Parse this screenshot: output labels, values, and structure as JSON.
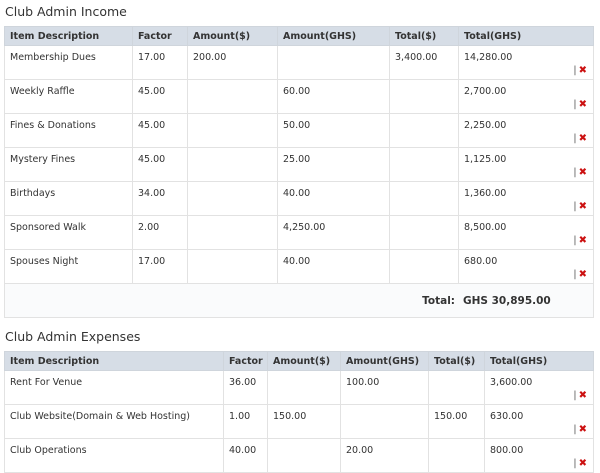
{
  "income": {
    "title": "Club Admin Income",
    "columns": [
      "Item Description",
      "Factor",
      "Amount($)",
      "Amount(GHS)",
      "Total($)",
      "Total(GHS)"
    ],
    "rows": [
      {
        "desc": "Membership Dues",
        "factor": "17.00",
        "amount_usd": "200.00",
        "amount_ghs": "",
        "total_usd": "3,400.00",
        "total_ghs": "14,280.00"
      },
      {
        "desc": "Weekly Raffle",
        "factor": "45.00",
        "amount_usd": "",
        "amount_ghs": "60.00",
        "total_usd": "",
        "total_ghs": "2,700.00"
      },
      {
        "desc": "Fines & Donations",
        "factor": "45.00",
        "amount_usd": "",
        "amount_ghs": "50.00",
        "total_usd": "",
        "total_ghs": "2,250.00"
      },
      {
        "desc": "Mystery Fines",
        "factor": "45.00",
        "amount_usd": "",
        "amount_ghs": "25.00",
        "total_usd": "",
        "total_ghs": "1,125.00"
      },
      {
        "desc": "Birthdays",
        "factor": "34.00",
        "amount_usd": "",
        "amount_ghs": "40.00",
        "total_usd": "",
        "total_ghs": "1,360.00"
      },
      {
        "desc": "Sponsored Walk",
        "factor": "2.00",
        "amount_usd": "",
        "amount_ghs": "4,250.00",
        "total_usd": "",
        "total_ghs": "8,500.00"
      },
      {
        "desc": "Spouses Night",
        "factor": "17.00",
        "amount_usd": "",
        "amount_ghs": "40.00",
        "total_usd": "",
        "total_ghs": "680.00"
      }
    ],
    "total_label": "Total:",
    "total_value": "GHS 30,895.00",
    "action_separator": "|",
    "delete_glyph": "✖"
  },
  "expenses": {
    "title": "Club Admin Expenses",
    "columns": [
      "Item Description",
      "Factor",
      "Amount($)",
      "Amount(GHS)",
      "Total($)",
      "Total(GHS)"
    ],
    "rows": [
      {
        "desc": "Rent For Venue",
        "factor": "36.00",
        "amount_usd": "",
        "amount_ghs": "100.00",
        "total_usd": "",
        "total_ghs": "3,600.00"
      },
      {
        "desc": "Club Website(Domain & Web Hosting)",
        "factor": "1.00",
        "amount_usd": "150.00",
        "amount_ghs": "",
        "total_usd": "150.00",
        "total_ghs": "630.00"
      },
      {
        "desc": "Club Operations",
        "factor": "40.00",
        "amount_usd": "",
        "amount_ghs": "20.00",
        "total_usd": "",
        "total_ghs": "800.00"
      }
    ]
  },
  "colors": {
    "header_bg": "#d6dde6",
    "delete_icon": "#cc1111"
  },
  "icons": {
    "delete": "delete-x-icon"
  }
}
